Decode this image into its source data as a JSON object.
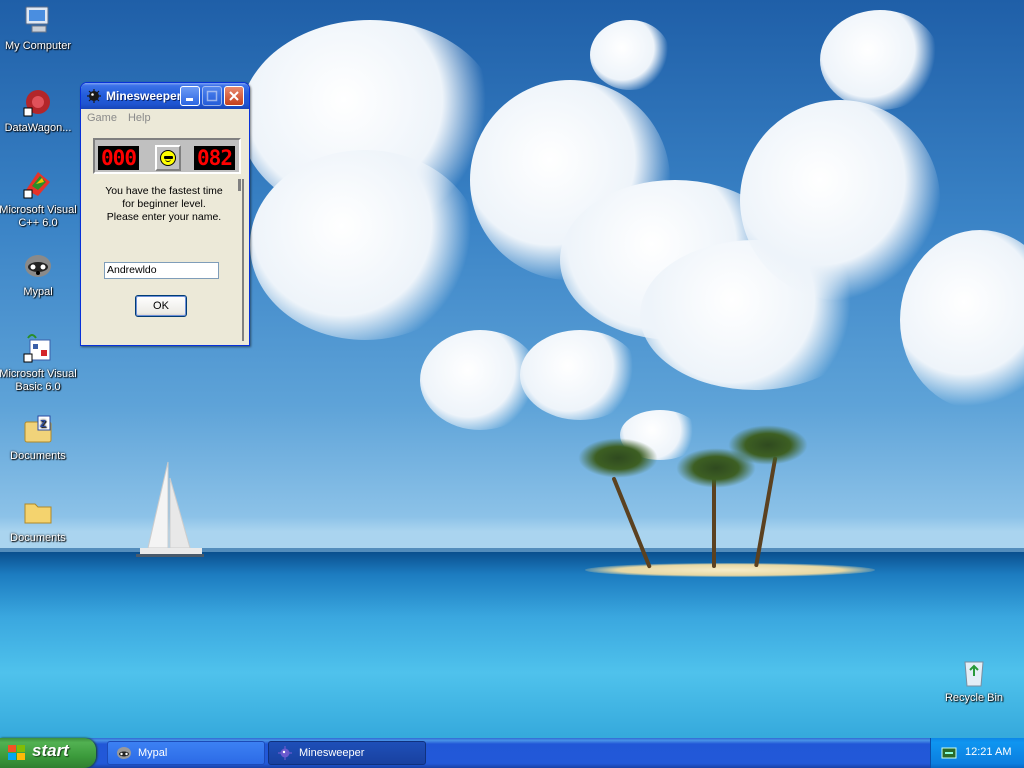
{
  "desktop": {
    "icons": [
      {
        "label": "My Computer",
        "icon": "my-computer-icon"
      },
      {
        "label": "DataWagon...",
        "icon": "datawagon-icon"
      },
      {
        "label": "Microsoft Visual C++ 6.0",
        "icon": "visual-cpp-icon"
      },
      {
        "label": "Mypal",
        "icon": "mypal-icon"
      },
      {
        "label": "Microsoft Visual Basic 6.0",
        "icon": "visual-basic-icon"
      },
      {
        "label": "Documents",
        "icon": "zip-folder-icon"
      },
      {
        "label": "Documents",
        "icon": "folder-icon"
      },
      {
        "label": "Recycle Bin",
        "icon": "recycle-bin-icon"
      }
    ]
  },
  "window": {
    "title": "Minesweeper",
    "menu": [
      "Game",
      "Help"
    ],
    "mine_counter": "000",
    "timer": "082",
    "dialog": {
      "message_line1": "You have the fastest time",
      "message_line2": "for beginner level.",
      "message_line3": "Please enter your name.",
      "name_value": "Andrewldo",
      "ok_label": "OK"
    }
  },
  "taskbar": {
    "start_label": "start",
    "tasks": [
      {
        "label": "Mypal",
        "icon": "mypal-icon",
        "active": false
      },
      {
        "label": "Minesweeper",
        "icon": "minesweeper-icon",
        "active": true
      }
    ],
    "clock": "12:21 AM"
  },
  "colors": {
    "taskbar_blue": "#245edb",
    "start_green": "#3c9b3c",
    "lcd_red": "#ff0000",
    "title_blue": "#235ddc"
  }
}
